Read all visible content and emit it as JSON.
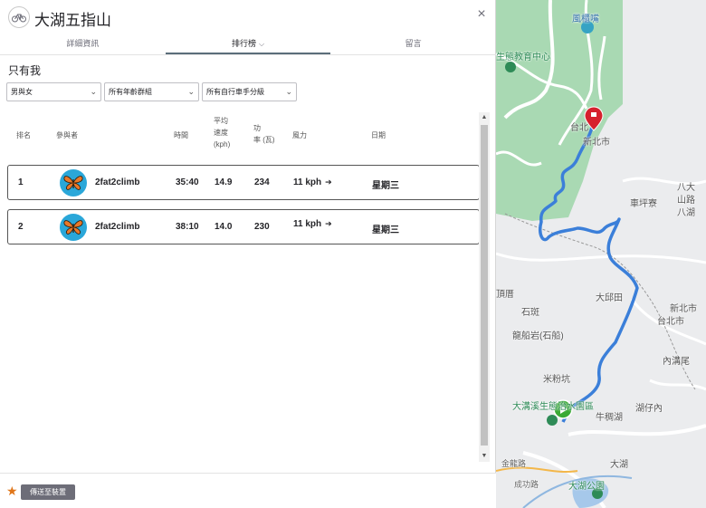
{
  "header": {
    "title": "大湖五指山",
    "sport_icon": "bike-icon",
    "close_label": "×"
  },
  "tabs": [
    {
      "label": "詳細資訊",
      "active": false
    },
    {
      "label": "排行榜",
      "active": true
    },
    {
      "label": "留言",
      "active": false
    }
  ],
  "filters": {
    "only_me": "只有我",
    "gender": "男與女",
    "age": "所有年齡群組",
    "weight": "所有自行車手分級"
  },
  "leaderboard": {
    "columns": {
      "rank": "排名",
      "athlete": "參與者",
      "time": "時間",
      "speed_line1": "平均",
      "speed_line2": "速度",
      "speed_line3": "(kph)",
      "power_line1": "功",
      "power_line2": "率 (瓦)",
      "wind": "風力",
      "date": "日期"
    },
    "rows": [
      {
        "rank": "1",
        "name": "2fat2climb",
        "time": "35:40",
        "speed": "14.9",
        "power": "234",
        "wind": "11 kph",
        "date": "星期三"
      },
      {
        "rank": "2",
        "name": "2fat2climb",
        "time": "38:10",
        "speed": "14.0",
        "power": "230",
        "wind": "11 kph",
        "date": "星期三"
      }
    ]
  },
  "footer": {
    "send_label": "傳送至裝置"
  },
  "map": {
    "labels": {
      "l1": "風櫃嘴",
      "l2": "生態教育中心",
      "l3": "台北",
      "l4": "新北市",
      "l5": "車坪寮",
      "l6": "大邱田",
      "l7": "頂厝",
      "l8": "石斑",
      "l9": "龍船岩(石船)",
      "l10": "新北市",
      "l11": "台北市",
      "l12": "內溝尾",
      "l13": "米粉坑",
      "l14": "大溝溪生態治水園區",
      "l15": "牛稠湖",
      "l16": "湖仔內",
      "l17": "大湖",
      "l18": "大湖公園",
      "l19": "金龍路",
      "l20": "成功路",
      "l21": "八大",
      "l22": "山路",
      "l23": "八湖"
    },
    "colors": {
      "route": "#3b7fd9",
      "park": "#a9d9b3",
      "start": "#3aaa35",
      "end": "#d6202d"
    }
  }
}
